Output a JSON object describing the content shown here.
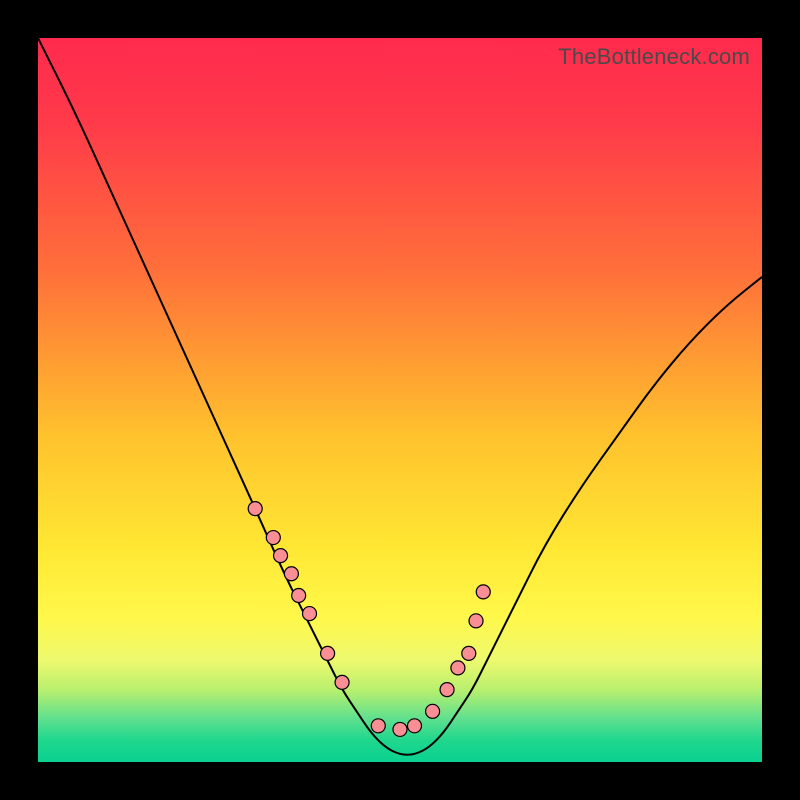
{
  "brand_text": "TheBottleneck.com",
  "chart_data": {
    "type": "line",
    "title": "",
    "xlabel": "",
    "ylabel": "",
    "xlim": [
      0,
      100
    ],
    "ylim": [
      0,
      100
    ],
    "series": [
      {
        "name": "bottleneck-curve",
        "x": [
          0,
          5,
          10,
          15,
          20,
          25,
          30,
          34,
          37,
          40,
          42,
          44,
          46,
          48,
          50,
          52,
          54,
          56,
          58,
          60,
          62,
          64,
          66,
          70,
          75,
          80,
          85,
          90,
          95,
          100
        ],
        "y": [
          100,
          90,
          79,
          68,
          57,
          46,
          35,
          26,
          20,
          14,
          10,
          7,
          4,
          2,
          1,
          1,
          2,
          4,
          7,
          10,
          14,
          18,
          22,
          30,
          38,
          45,
          52,
          58,
          63,
          67
        ]
      }
    ],
    "markers": {
      "name": "highlighted-points",
      "x_pct": [
        30,
        32.5,
        33.5,
        35,
        36,
        37.5,
        40,
        42,
        47,
        50,
        52,
        54.5,
        56.5,
        58,
        59.5,
        60.5,
        61.5
      ],
      "y_pct": [
        65,
        69,
        71.5,
        74,
        77,
        79.5,
        85,
        89,
        95,
        95.5,
        95,
        93,
        90,
        87,
        85,
        80.5,
        76.5
      ]
    },
    "colors": {
      "gradient_top": "#ff2a4d",
      "gradient_mid": "#ffe633",
      "gradient_bottom": "#0ad191",
      "curve": "#000000",
      "marker_fill": "#f98f95"
    }
  }
}
